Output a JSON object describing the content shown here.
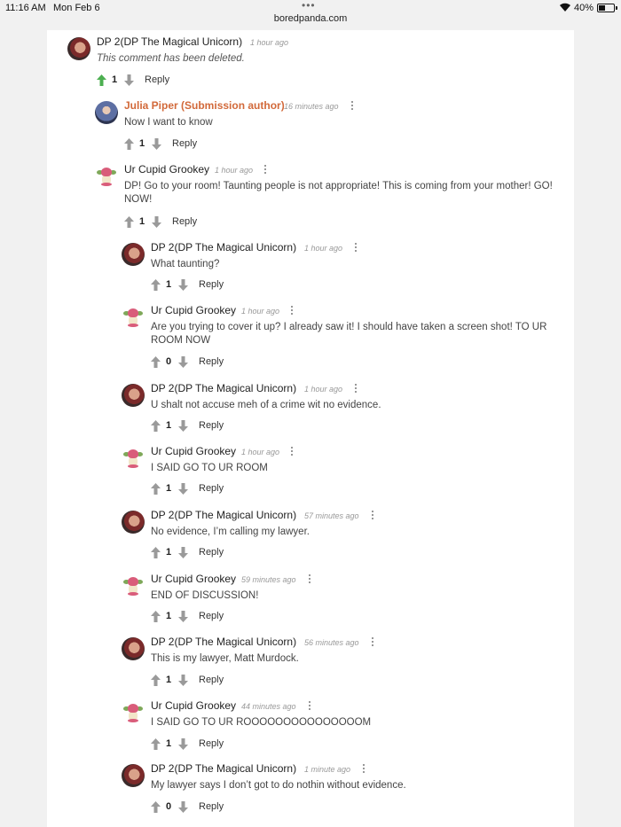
{
  "status_bar": {
    "time": "11:16 AM",
    "date": "Mon Feb 6",
    "battery": "40%"
  },
  "url": "boredpanda.com",
  "vote_colors": {
    "upvoted": "#4caf50",
    "neutral": "#9a9a9a",
    "submission_author": "#d2693a"
  },
  "comments": [
    {
      "author": "DP 2(DP The Magical Unicorn)",
      "time": "1 hour ago",
      "text": "This comment has been deleted.",
      "votes": "1",
      "reply": "Reply",
      "avatar": "dp-avatar"
    },
    {
      "author": "Julia Piper (Submission author)",
      "time": "16 minutes ago",
      "text": "Now I want to know",
      "votes": "1",
      "reply": "Reply",
      "avatar": "julia-avatar"
    },
    {
      "author": "Ur Cupid Grookey",
      "time": "1 hour ago",
      "text": "DP! Go to your room! Taunting people is not appropriate! This is coming from your mother! GO! NOW!",
      "votes": "1",
      "reply": "Reply",
      "avatar": "cupid-avatar"
    },
    {
      "author": "DP 2(DP The Magical Unicorn)",
      "time": "1 hour ago",
      "text": "What taunting?",
      "votes": "1",
      "reply": "Reply",
      "avatar": "dp-avatar"
    },
    {
      "author": "Ur Cupid Grookey",
      "time": "1 hour ago",
      "text": "Are you trying to cover it up? I already saw it! I should have taken a screen shot! TO UR ROOM NOW",
      "votes": "0",
      "reply": "Reply",
      "avatar": "cupid-avatar"
    },
    {
      "author": "DP 2(DP The Magical Unicorn)",
      "time": "1 hour ago",
      "text": "U shalt not accuse meh of a crime wit no evidence.",
      "votes": "1",
      "reply": "Reply",
      "avatar": "dp-avatar"
    },
    {
      "author": "Ur Cupid Grookey",
      "time": "1 hour ago",
      "text": "I SAID GO TO UR ROOM",
      "votes": "1",
      "reply": "Reply",
      "avatar": "cupid-avatar"
    },
    {
      "author": "DP 2(DP The Magical Unicorn)",
      "time": "57 minutes ago",
      "text": "No evidence, I’m calling my lawyer.",
      "votes": "1",
      "reply": "Reply",
      "avatar": "dp-avatar"
    },
    {
      "author": "Ur Cupid Grookey",
      "time": "59 minutes ago",
      "text": "END OF DISCUSSION!",
      "votes": "1",
      "reply": "Reply",
      "avatar": "cupid-avatar"
    },
    {
      "author": "DP 2(DP The Magical Unicorn)",
      "time": "56 minutes ago",
      "text": "This is my lawyer, Matt Murdock.",
      "votes": "1",
      "reply": "Reply",
      "avatar": "dp-avatar"
    },
    {
      "author": "Ur Cupid Grookey",
      "time": "44 minutes ago",
      "text": "I SAID GO TO UR ROOOOOOOOOOOOOOOM",
      "votes": "1",
      "reply": "Reply",
      "avatar": "cupid-avatar"
    },
    {
      "author": "DP 2(DP The Magical Unicorn)",
      "time": "1 minute ago",
      "text": "My lawyer says I don’t got to do nothin without evidence.",
      "votes": "0",
      "reply": "Reply",
      "avatar": "dp-avatar"
    }
  ]
}
